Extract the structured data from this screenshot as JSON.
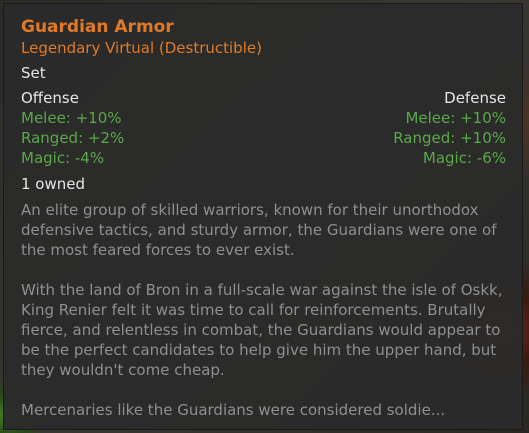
{
  "item": {
    "name": "Guardian Armor",
    "rarity": "Legendary Virtual (Destructible)",
    "category": "Set",
    "owned": "1 owned"
  },
  "offense": {
    "heading": "Offense",
    "melee": "Melee: +10%",
    "ranged": "Ranged: +2%",
    "magic": "Magic: -4%"
  },
  "defense": {
    "heading": "Defense",
    "melee": "Melee: +10%",
    "ranged": "Ranged: +10%",
    "magic": "Magic: -6%"
  },
  "description": {
    "p1": "An elite group of skilled warriors, known for their unorthodox defensive tactics, and sturdy armor, the Guardians were one of the most feared forces to ever exist.",
    "p2": "With the land of Bron in a full-scale war against the isle of Oskk, King Renier felt it was time to call for reinforcements. Brutally fierce, and relentless in combat, the Guardians would appear to be the perfect candidates to help give him the upper hand, but they wouldn't come cheap.",
    "p3": "Mercenaries like the Guardians were considered soldie..."
  },
  "colors": {
    "title": "#e07a28",
    "stat_positive": "#5aa84a",
    "text": "#e6e6e6",
    "flavor_text": "#8f8f8f",
    "panel_bg": "#2b2b2b"
  }
}
